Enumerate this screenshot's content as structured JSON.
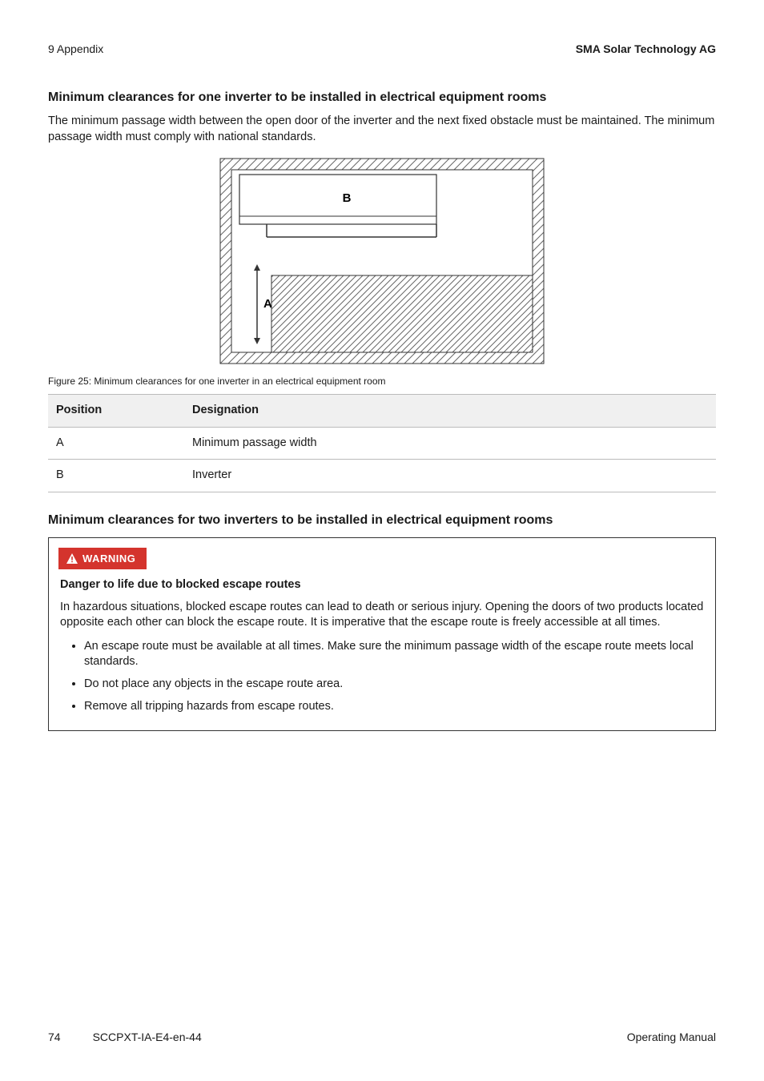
{
  "header": {
    "left": "9 Appendix",
    "right": "SMA Solar Technology AG"
  },
  "section1": {
    "title": "Minimum clearances for one inverter to be installed in electrical equipment rooms",
    "para": "The minimum passage width between the open door of the inverter and the next fixed obstacle must be maintained. The minimum passage width must comply with national standards.",
    "figCaption": "Figure 25: Minimum clearances for one inverter in an electrical equipment room",
    "figLabels": {
      "A": "A",
      "B": "B"
    },
    "table": {
      "head": {
        "c1": "Position",
        "c2": "Designation"
      },
      "rows": [
        {
          "c1": "A",
          "c2": "Minimum passage width"
        },
        {
          "c1": "B",
          "c2": "Inverter"
        }
      ]
    }
  },
  "section2": {
    "title": "Minimum clearances for two inverters to be installed in electrical equipment rooms",
    "warnLabel": "WARNING",
    "warnTitle": "Danger to life due to blocked escape routes",
    "warnPara": "In hazardous situations, blocked escape routes can lead to death or serious injury. Opening the doors of two products located opposite each other can block the escape route. It is imperative that the escape route is freely accessible at all times.",
    "bullets": [
      "An escape route must be available at all times. Make sure the minimum passage width of the escape route meets local standards.",
      "Do not place any objects in the escape route area.",
      "Remove all tripping hazards from escape routes."
    ]
  },
  "footer": {
    "page": "74",
    "docid": "SCCPXT-IA-E4-en-44",
    "right": "Operating Manual"
  }
}
